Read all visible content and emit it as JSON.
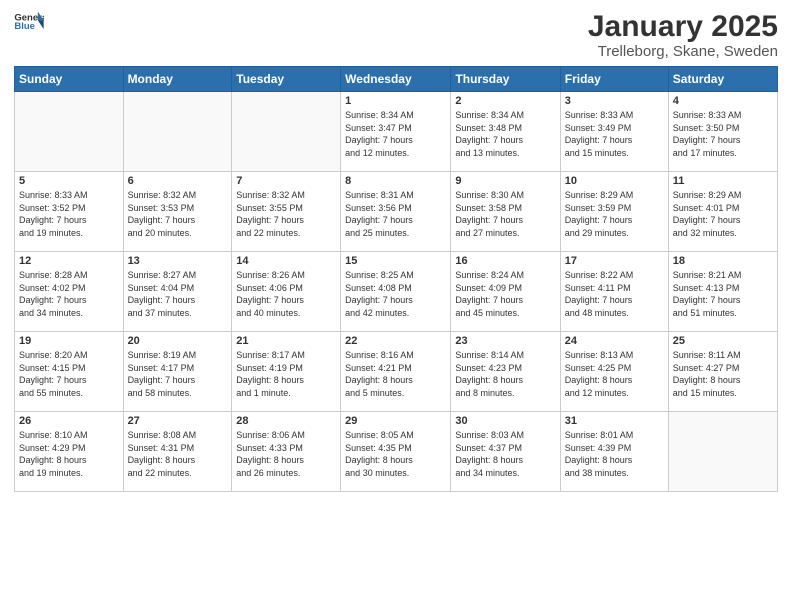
{
  "header": {
    "logo_general": "General",
    "logo_blue": "Blue",
    "month": "January 2025",
    "location": "Trelleborg, Skane, Sweden"
  },
  "weekdays": [
    "Sunday",
    "Monday",
    "Tuesday",
    "Wednesday",
    "Thursday",
    "Friday",
    "Saturday"
  ],
  "weeks": [
    [
      {
        "day": "",
        "info": ""
      },
      {
        "day": "",
        "info": ""
      },
      {
        "day": "",
        "info": ""
      },
      {
        "day": "1",
        "info": "Sunrise: 8:34 AM\nSunset: 3:47 PM\nDaylight: 7 hours\nand 12 minutes."
      },
      {
        "day": "2",
        "info": "Sunrise: 8:34 AM\nSunset: 3:48 PM\nDaylight: 7 hours\nand 13 minutes."
      },
      {
        "day": "3",
        "info": "Sunrise: 8:33 AM\nSunset: 3:49 PM\nDaylight: 7 hours\nand 15 minutes."
      },
      {
        "day": "4",
        "info": "Sunrise: 8:33 AM\nSunset: 3:50 PM\nDaylight: 7 hours\nand 17 minutes."
      }
    ],
    [
      {
        "day": "5",
        "info": "Sunrise: 8:33 AM\nSunset: 3:52 PM\nDaylight: 7 hours\nand 19 minutes."
      },
      {
        "day": "6",
        "info": "Sunrise: 8:32 AM\nSunset: 3:53 PM\nDaylight: 7 hours\nand 20 minutes."
      },
      {
        "day": "7",
        "info": "Sunrise: 8:32 AM\nSunset: 3:55 PM\nDaylight: 7 hours\nand 22 minutes."
      },
      {
        "day": "8",
        "info": "Sunrise: 8:31 AM\nSunset: 3:56 PM\nDaylight: 7 hours\nand 25 minutes."
      },
      {
        "day": "9",
        "info": "Sunrise: 8:30 AM\nSunset: 3:58 PM\nDaylight: 7 hours\nand 27 minutes."
      },
      {
        "day": "10",
        "info": "Sunrise: 8:29 AM\nSunset: 3:59 PM\nDaylight: 7 hours\nand 29 minutes."
      },
      {
        "day": "11",
        "info": "Sunrise: 8:29 AM\nSunset: 4:01 PM\nDaylight: 7 hours\nand 32 minutes."
      }
    ],
    [
      {
        "day": "12",
        "info": "Sunrise: 8:28 AM\nSunset: 4:02 PM\nDaylight: 7 hours\nand 34 minutes."
      },
      {
        "day": "13",
        "info": "Sunrise: 8:27 AM\nSunset: 4:04 PM\nDaylight: 7 hours\nand 37 minutes."
      },
      {
        "day": "14",
        "info": "Sunrise: 8:26 AM\nSunset: 4:06 PM\nDaylight: 7 hours\nand 40 minutes."
      },
      {
        "day": "15",
        "info": "Sunrise: 8:25 AM\nSunset: 4:08 PM\nDaylight: 7 hours\nand 42 minutes."
      },
      {
        "day": "16",
        "info": "Sunrise: 8:24 AM\nSunset: 4:09 PM\nDaylight: 7 hours\nand 45 minutes."
      },
      {
        "day": "17",
        "info": "Sunrise: 8:22 AM\nSunset: 4:11 PM\nDaylight: 7 hours\nand 48 minutes."
      },
      {
        "day": "18",
        "info": "Sunrise: 8:21 AM\nSunset: 4:13 PM\nDaylight: 7 hours\nand 51 minutes."
      }
    ],
    [
      {
        "day": "19",
        "info": "Sunrise: 8:20 AM\nSunset: 4:15 PM\nDaylight: 7 hours\nand 55 minutes."
      },
      {
        "day": "20",
        "info": "Sunrise: 8:19 AM\nSunset: 4:17 PM\nDaylight: 7 hours\nand 58 minutes."
      },
      {
        "day": "21",
        "info": "Sunrise: 8:17 AM\nSunset: 4:19 PM\nDaylight: 8 hours\nand 1 minute."
      },
      {
        "day": "22",
        "info": "Sunrise: 8:16 AM\nSunset: 4:21 PM\nDaylight: 8 hours\nand 5 minutes."
      },
      {
        "day": "23",
        "info": "Sunrise: 8:14 AM\nSunset: 4:23 PM\nDaylight: 8 hours\nand 8 minutes."
      },
      {
        "day": "24",
        "info": "Sunrise: 8:13 AM\nSunset: 4:25 PM\nDaylight: 8 hours\nand 12 minutes."
      },
      {
        "day": "25",
        "info": "Sunrise: 8:11 AM\nSunset: 4:27 PM\nDaylight: 8 hours\nand 15 minutes."
      }
    ],
    [
      {
        "day": "26",
        "info": "Sunrise: 8:10 AM\nSunset: 4:29 PM\nDaylight: 8 hours\nand 19 minutes."
      },
      {
        "day": "27",
        "info": "Sunrise: 8:08 AM\nSunset: 4:31 PM\nDaylight: 8 hours\nand 22 minutes."
      },
      {
        "day": "28",
        "info": "Sunrise: 8:06 AM\nSunset: 4:33 PM\nDaylight: 8 hours\nand 26 minutes."
      },
      {
        "day": "29",
        "info": "Sunrise: 8:05 AM\nSunset: 4:35 PM\nDaylight: 8 hours\nand 30 minutes."
      },
      {
        "day": "30",
        "info": "Sunrise: 8:03 AM\nSunset: 4:37 PM\nDaylight: 8 hours\nand 34 minutes."
      },
      {
        "day": "31",
        "info": "Sunrise: 8:01 AM\nSunset: 4:39 PM\nDaylight: 8 hours\nand 38 minutes."
      },
      {
        "day": "",
        "info": ""
      }
    ]
  ]
}
